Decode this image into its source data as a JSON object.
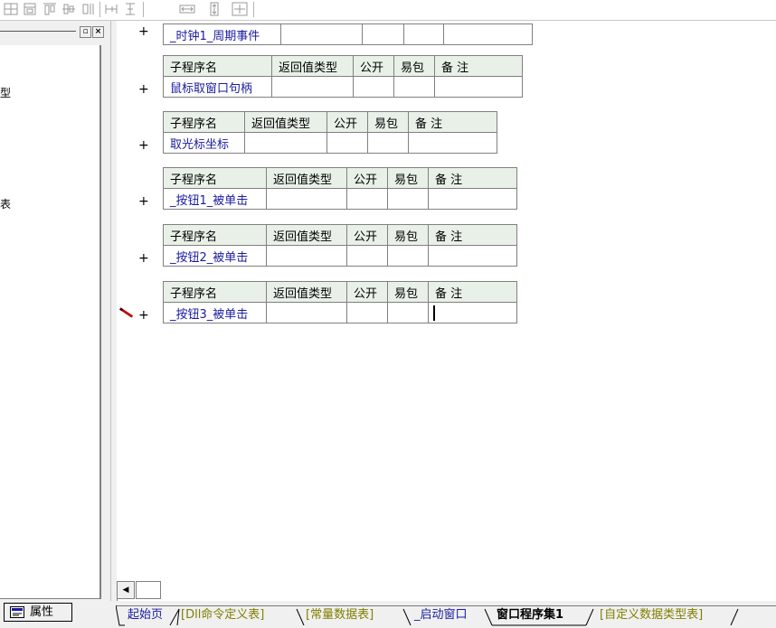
{
  "toolbar": {
    "icons": [
      "align-left-icon",
      "align-center-icon",
      "align-top-icon",
      "align-middle-icon",
      "same-width-icon",
      "same-height-icon",
      "h-center-icon",
      "v-center-icon",
      "center-both-icon"
    ]
  },
  "left_panel": {
    "close_label": "×",
    "truncated_1": "型",
    "truncated_2": "表"
  },
  "properties_button": {
    "label": "属性"
  },
  "subprograms": [
    {
      "name": "_时钟1_周期事件",
      "show_header": false
    },
    {
      "name": "鼠标取窗口句柄",
      "show_header": true
    },
    {
      "name": "取光标坐标",
      "show_header": true
    },
    {
      "name": "_按钮1_被单击",
      "show_header": true
    },
    {
      "name": "_按钮2_被单击",
      "show_header": true
    },
    {
      "name": "_按钮3_被单击",
      "show_header": true
    }
  ],
  "table_headers": {
    "name": "子程序名",
    "return_type": "返回值类型",
    "public": "公开",
    "easy_pack": "易包",
    "remark": "备 注"
  },
  "expand_symbol": "+",
  "tabs": [
    {
      "label": "起始页",
      "style": "blue"
    },
    {
      "label": "[Dll命令定义表]",
      "style": "olive"
    },
    {
      "label": "[常量数据表]",
      "style": "olive"
    },
    {
      "label": "_启动窗口",
      "style": "blue"
    },
    {
      "label": "窗口程序集1",
      "style": "active"
    },
    {
      "label": "[自定义数据类型表]",
      "style": "olive"
    }
  ],
  "colors": {
    "header_bg": "#e8f0e8",
    "sub_name": "#1a1aa0",
    "tab_olive": "#808000",
    "pen": "#c00000"
  }
}
